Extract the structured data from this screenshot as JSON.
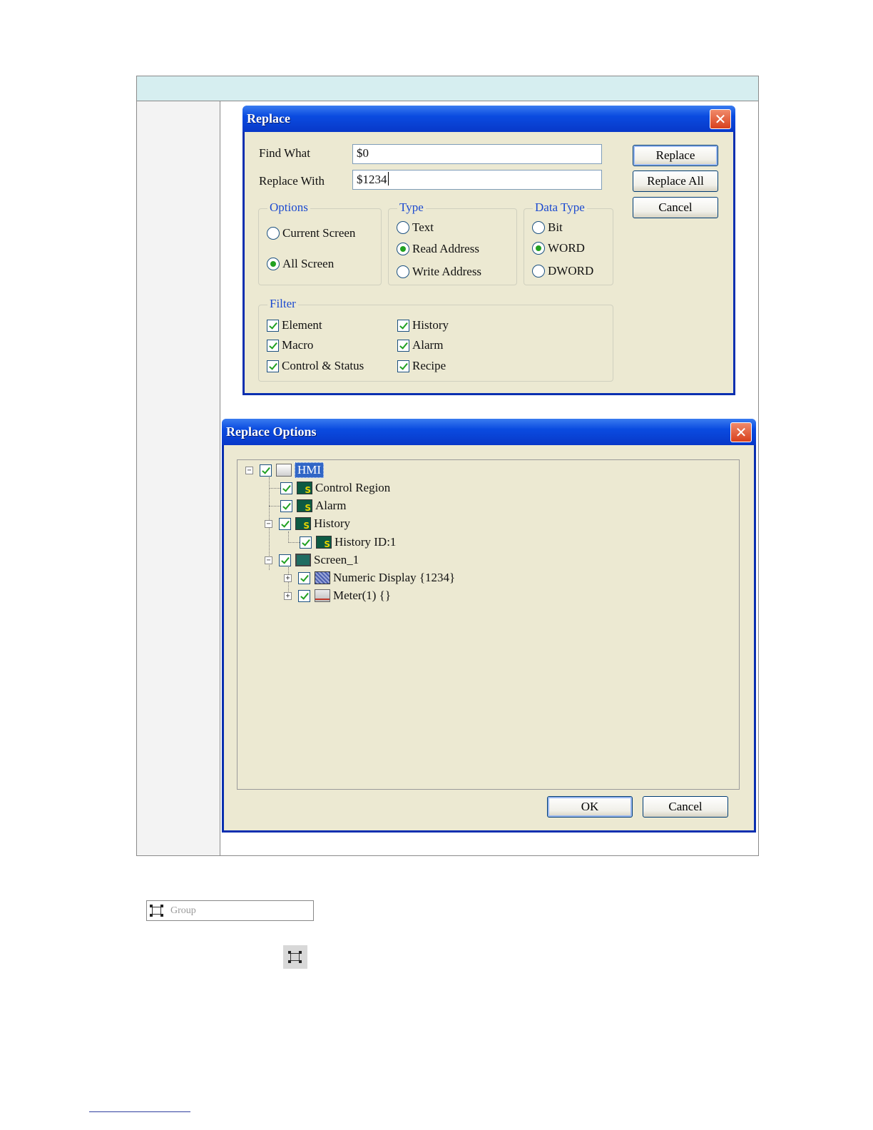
{
  "replace_dialog": {
    "title": "Replace",
    "find_label": "Find What",
    "find_value": "$0",
    "replace_label": "Replace With",
    "replace_value": "$1234",
    "buttons": {
      "replace": "Replace",
      "replace_all": "Replace All",
      "cancel": "Cancel"
    },
    "options": {
      "legend": "Options",
      "current_screen": "Current Screen",
      "all_screen": "All Screen",
      "selected": "All Screen"
    },
    "type": {
      "legend": "Type",
      "text": "Text",
      "read_address": "Read Address",
      "write_address": "Write Address",
      "selected": "Read Address"
    },
    "data_type": {
      "legend": "Data Type",
      "bit": "Bit",
      "word": "WORD",
      "dword": "DWORD",
      "selected": "WORD"
    },
    "filter": {
      "legend": "Filter",
      "element": "Element",
      "macro": "Macro",
      "control_status": "Control & Status",
      "history": "History",
      "alarm": "Alarm",
      "recipe": "Recipe"
    }
  },
  "replace_options_dialog": {
    "title": "Replace Options",
    "tree": {
      "root": "HMI",
      "control_region": "Control Region",
      "alarm": "Alarm",
      "history": "History",
      "history_id": "History ID:1",
      "screen": "Screen_1",
      "numeric_display": "Numeric Display {1234}",
      "meter": "Meter(1) {}"
    },
    "buttons": {
      "ok": "OK",
      "cancel": "Cancel"
    }
  },
  "toolbar_group": {
    "label": "Group",
    "icon": "group-icon"
  },
  "colors": {
    "title_bar": "#0a4be0",
    "dialog_bg": "#ece9d2",
    "close": "#d8401c",
    "check": "#21a121",
    "header_band": "#d6eef0"
  }
}
